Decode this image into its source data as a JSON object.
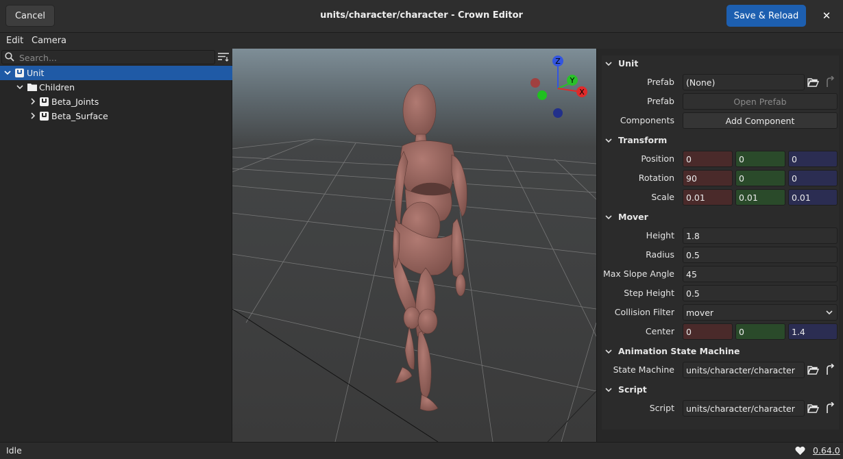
{
  "window": {
    "title": "units/character/character - Crown Editor",
    "cancel_label": "Cancel",
    "save_label": "Save & Reload",
    "close_glyph": "✕"
  },
  "menu": [
    "Edit",
    "Camera"
  ],
  "search": {
    "placeholder": "Search..."
  },
  "tree": [
    {
      "label": "Unit",
      "icon": "unit-icon",
      "expanded": true,
      "selected": true
    },
    {
      "label": "Children",
      "icon": "folder-icon",
      "expanded": true
    },
    {
      "label": "Beta_Joints",
      "icon": "unit-icon",
      "expanded": false
    },
    {
      "label": "Beta_Surface",
      "icon": "unit-icon",
      "expanded": false
    }
  ],
  "gizmo": {
    "x_label": "X",
    "y_label": "Y",
    "z_label": "Z"
  },
  "colors": {
    "accent": "#1f5aa6",
    "x_axis": "#e03030",
    "y_axis": "#30c030",
    "z_axis": "#3050d0"
  },
  "sections": {
    "unit": {
      "title": "Unit",
      "prefab_label": "Prefab",
      "prefab_value": "(None)",
      "open_prefab_label": "Prefab",
      "open_prefab_button": "Open Prefab",
      "components_label": "Components",
      "add_component_button": "Add Component"
    },
    "transform": {
      "title": "Transform",
      "position_label": "Position",
      "position": [
        "0",
        "0",
        "0"
      ],
      "rotation_label": "Rotation",
      "rotation": [
        "90",
        "0",
        "0"
      ],
      "scale_label": "Scale",
      "scale": [
        "0.01",
        "0.01",
        "0.01"
      ]
    },
    "mover": {
      "title": "Mover",
      "height_label": "Height",
      "height": "1.8",
      "radius_label": "Radius",
      "radius": "0.5",
      "max_slope_label": "Max Slope Angle",
      "max_slope": "45",
      "step_height_label": "Step Height",
      "step_height": "0.5",
      "collision_filter_label": "Collision Filter",
      "collision_filter": "mover",
      "center_label": "Center",
      "center": [
        "0",
        "0",
        "1.4"
      ]
    },
    "asm": {
      "title": "Animation State Machine",
      "state_machine_label": "State Machine",
      "state_machine": "units/character/character"
    },
    "script": {
      "title": "Script",
      "script_label": "Script",
      "script": "units/character/character"
    }
  },
  "status": {
    "text": "Idle",
    "version": "0.64.0"
  }
}
